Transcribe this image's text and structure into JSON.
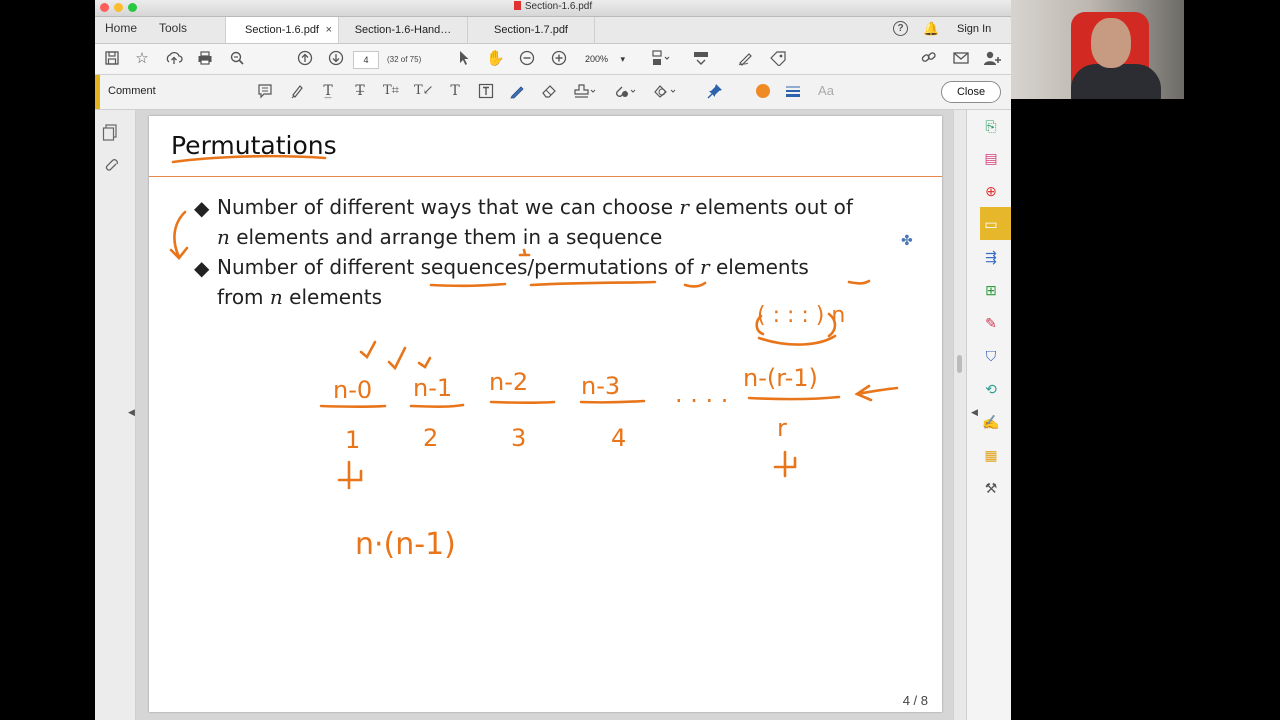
{
  "window": {
    "title": "Section-1.6.pdf"
  },
  "nav": {
    "home": "Home",
    "tools": "Tools"
  },
  "tabs": [
    {
      "label": "Section-1.6.pdf",
      "active": true,
      "close": "×"
    },
    {
      "label": "Section-1.6-Hand…",
      "active": false
    },
    {
      "label": "Section-1.7.pdf",
      "active": false
    }
  ],
  "account": {
    "help": "?",
    "sign_in": "Sign In"
  },
  "toolbar": {
    "page_input": "4",
    "page_count": "(32 of 75)",
    "zoom": "200%"
  },
  "comment_bar": {
    "label": "Comment",
    "text_style": "Aa",
    "close": "Close",
    "color": "#f08a24"
  },
  "slide": {
    "title": "Permutations",
    "bullet1": {
      "before": "Number of different ways that we can choose ",
      "var_r": "r",
      "middle": " elements out of ",
      "var_n": "n",
      "after": " elements and arrange them in a sequence"
    },
    "bullet2": {
      "before": "Number of different sequences/permutations of ",
      "var_r": "r",
      "middle": " elements from ",
      "var_n": "n",
      "after": " elements"
    },
    "page_number": "4 / 8"
  },
  "handwriting": {
    "slot_labels": [
      "n-0",
      "n-1",
      "n-2",
      "n-3",
      "n-(r-1)"
    ],
    "position_labels": [
      "1",
      "2",
      "3",
      "4",
      "r"
    ],
    "dots": ". . . .",
    "product": "n·(n-1)",
    "set_note": "( : : : ) n",
    "ink_color": "#e8751a"
  }
}
